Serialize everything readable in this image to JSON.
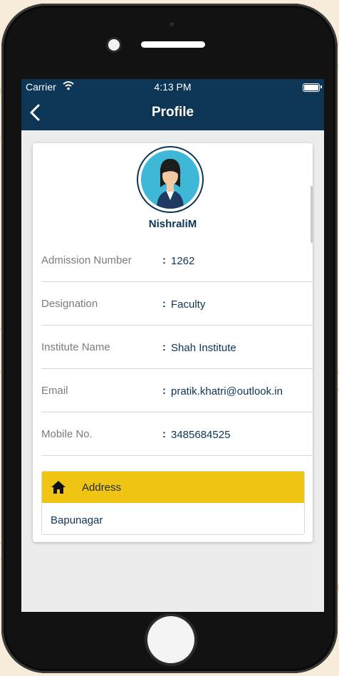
{
  "status_bar": {
    "carrier": "Carrier",
    "time": "4:13 PM"
  },
  "navbar": {
    "title": "Profile"
  },
  "profile": {
    "username": "NishraliM",
    "fields": [
      {
        "label": "Admission Number",
        "value": "1262"
      },
      {
        "label": "Designation",
        "value": "Faculty"
      },
      {
        "label": "Institute Name",
        "value": "Shah Institute"
      },
      {
        "label": "Email",
        "value": "pratik.khatri@outlook.in"
      },
      {
        "label": "Mobile No.",
        "value": "3485684525"
      }
    ],
    "separator": ":",
    "address": {
      "title": "Address",
      "value": "Bapunagar"
    }
  },
  "colors": {
    "navbar": "#0c3556",
    "address_header": "#f0c413",
    "avatar_bg": "#3fb7d6"
  },
  "icons": {
    "back": "chevron-left-icon",
    "wifi": "wifi-icon",
    "battery": "battery-icon",
    "home": "home-icon",
    "avatar": "user-avatar-icon"
  }
}
